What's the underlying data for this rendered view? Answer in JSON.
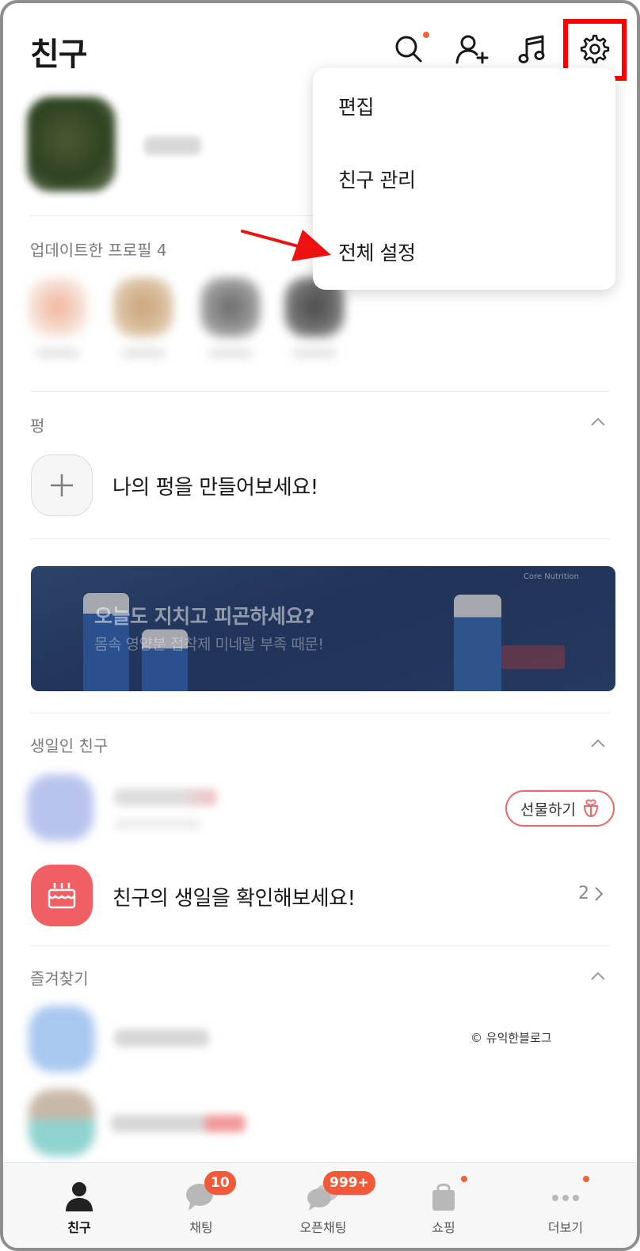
{
  "header": {
    "title": "친구"
  },
  "updated_profiles": {
    "label": "업데이트한 프로필 4"
  },
  "pung": {
    "label": "펑",
    "cta": "나의 펑을 만들어보세요!"
  },
  "banner": {
    "headline": "오늘도 지치고 피곤하세요?",
    "subline": "몸속 영양분 접착제 미네랄 부족 때문!",
    "brand": "Core Nutrition"
  },
  "birthday": {
    "label": "생일인 친구",
    "gift_button": "선물하기",
    "cta": "친구의 생일을 확인해보세요!",
    "count": "2"
  },
  "favorites": {
    "label": "즐겨찾기"
  },
  "watermark": "© 유익한블로그",
  "menu": {
    "items": [
      "편집",
      "친구 관리",
      "전체 설정"
    ]
  },
  "tabbar": {
    "tabs": [
      {
        "label": "친구",
        "badge": ""
      },
      {
        "label": "채팅",
        "badge": "10"
      },
      {
        "label": "오픈채팅",
        "badge": "999+"
      },
      {
        "label": "쇼핑",
        "badge": ""
      },
      {
        "label": "더보기",
        "badge": ""
      }
    ]
  },
  "colors": {
    "accent_red": "#f05a3a",
    "highlight_box": "#ff0000",
    "cake_tile": "#f05f63"
  },
  "icons": [
    "search-icon",
    "add-friend-icon",
    "music-note-icon",
    "gear-icon",
    "plus-icon",
    "cake-icon",
    "gift-icon",
    "chevron-up-icon",
    "chevron-right-icon",
    "person-icon",
    "chat-bubble-icon",
    "open-chat-icon",
    "shopping-bag-icon",
    "more-dots-icon"
  ]
}
